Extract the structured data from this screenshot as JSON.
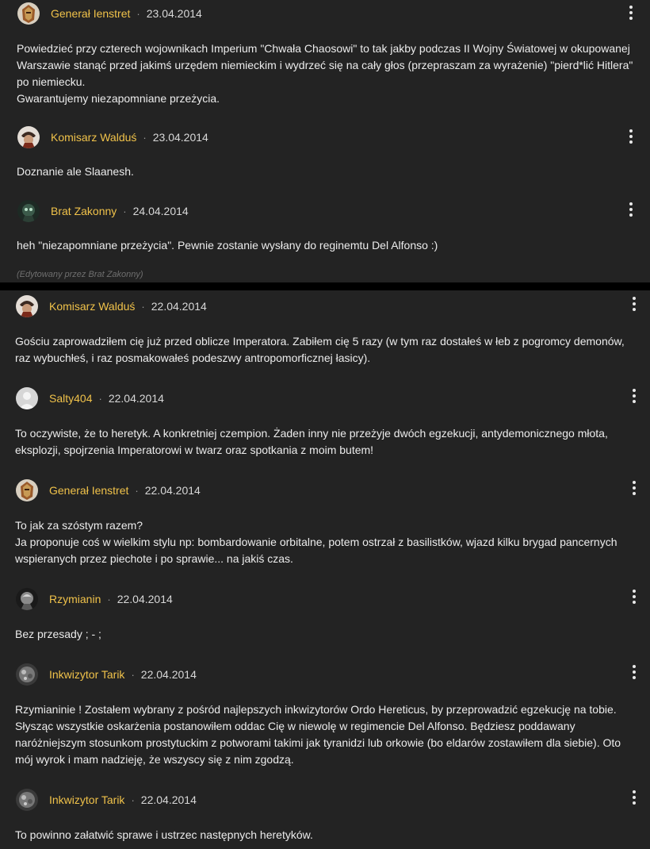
{
  "comments_top": [
    {
      "author": "Generał Ienstret",
      "date": "23.04.2014",
      "avatar_icon": "general-ienstret-avatar",
      "text": "Powiedzieć przy czterech wojownikach Imperium \"Chwała Chaosowi\" to tak jakby podczas II Wojny Światowej w okupowanej Warszawie stanąć przed jakimś urzędem niemieckim i wydrzeć się na cały głos (przepraszam za wyrażenie) \"pierd*lić Hitlera\" po niemiecku.\nGwarantujemy niezapomniane przeżycia."
    },
    {
      "author": "Komisarz Walduś",
      "date": "23.04.2014",
      "avatar_icon": "komisarz-walduś-avatar",
      "text": "Doznanie ale Slaanesh."
    },
    {
      "author": "Brat Zakonny",
      "date": "24.04.2014",
      "avatar_icon": "brat-zakonny-avatar",
      "text": "heh \"niezapomniane przeżycia\". Pewnie zostanie wysłany do reginemtu Del Alfonso :)",
      "edit_note": "(Edytowany przez Brat Zakonny)"
    }
  ],
  "comments_bottom": [
    {
      "author": "Komisarz Walduś",
      "date": "22.04.2014",
      "avatar_icon": "komisarz-walduś-avatar",
      "text": "Gościu zaprowadziłem cię już przed oblicze Imperatora. Zabiłem cię 5 razy (w tym raz dostałeś w łeb z pogromcy demonów, raz wybuchłeś, i raz posmakowałeś podeszwy antropomorficznej łasicy)."
    },
    {
      "author": "Salty404",
      "date": "22.04.2014",
      "avatar_icon": "default-user-avatar",
      "text": "To oczywiste, że to heretyk. A konkretniej czempion. Żaden inny nie przeżyje dwóch egzekucji, antydemonicznego młota, eksplozji, spojrzenia Imperatorowi w twarz oraz spotkania z moim butem!"
    },
    {
      "author": "Generał Ienstret",
      "date": "22.04.2014",
      "avatar_icon": "general-ienstret-avatar",
      "text": "To jak za szóstym razem?\nJa proponuje coś w wielkim stylu np: bombardowanie orbitalne, potem ostrzał z basilistków, wjazd kilku brygad pancernych wspieranych przez piechote i po sprawie... na jakiś czas."
    },
    {
      "author": "Rzymianin",
      "date": "22.04.2014",
      "avatar_icon": "rzymianin-avatar",
      "text": "Bez przesady ; - ;"
    },
    {
      "author": "Inkwizytor Tarik",
      "date": "22.04.2014",
      "avatar_icon": "inkwizytor-tarik-avatar",
      "text": "Rzymianinie ! Zostałem wybrany z pośród najlepszych inkwizytorów Ordo Hereticus, by przeprowadzić egzekucję na tobie. Słysząc wszystkie oskarżenia postanowiłem oddac Cię w niewolę w regimencie Del Alfonso. Będziesz poddawany naróżniejszym stosunkom prostytuckim z potworami takimi jak tyranidzi lub orkowie (bo eldarów zostawiłem dla siebie). Oto mój wyrok i mam nadzieję, że wszyscy się z nim zgodzą."
    },
    {
      "author": "Inkwizytor Tarik",
      "date": "22.04.2014",
      "avatar_icon": "inkwizytor-tarik-avatar",
      "text": "To powinno załatwić sprawe i ustrzec następnych heretyków."
    }
  ],
  "separator": "·",
  "colors": {
    "background": "#232323",
    "author": "#f0c24a",
    "text": "#ececec",
    "divider": "#000000"
  }
}
